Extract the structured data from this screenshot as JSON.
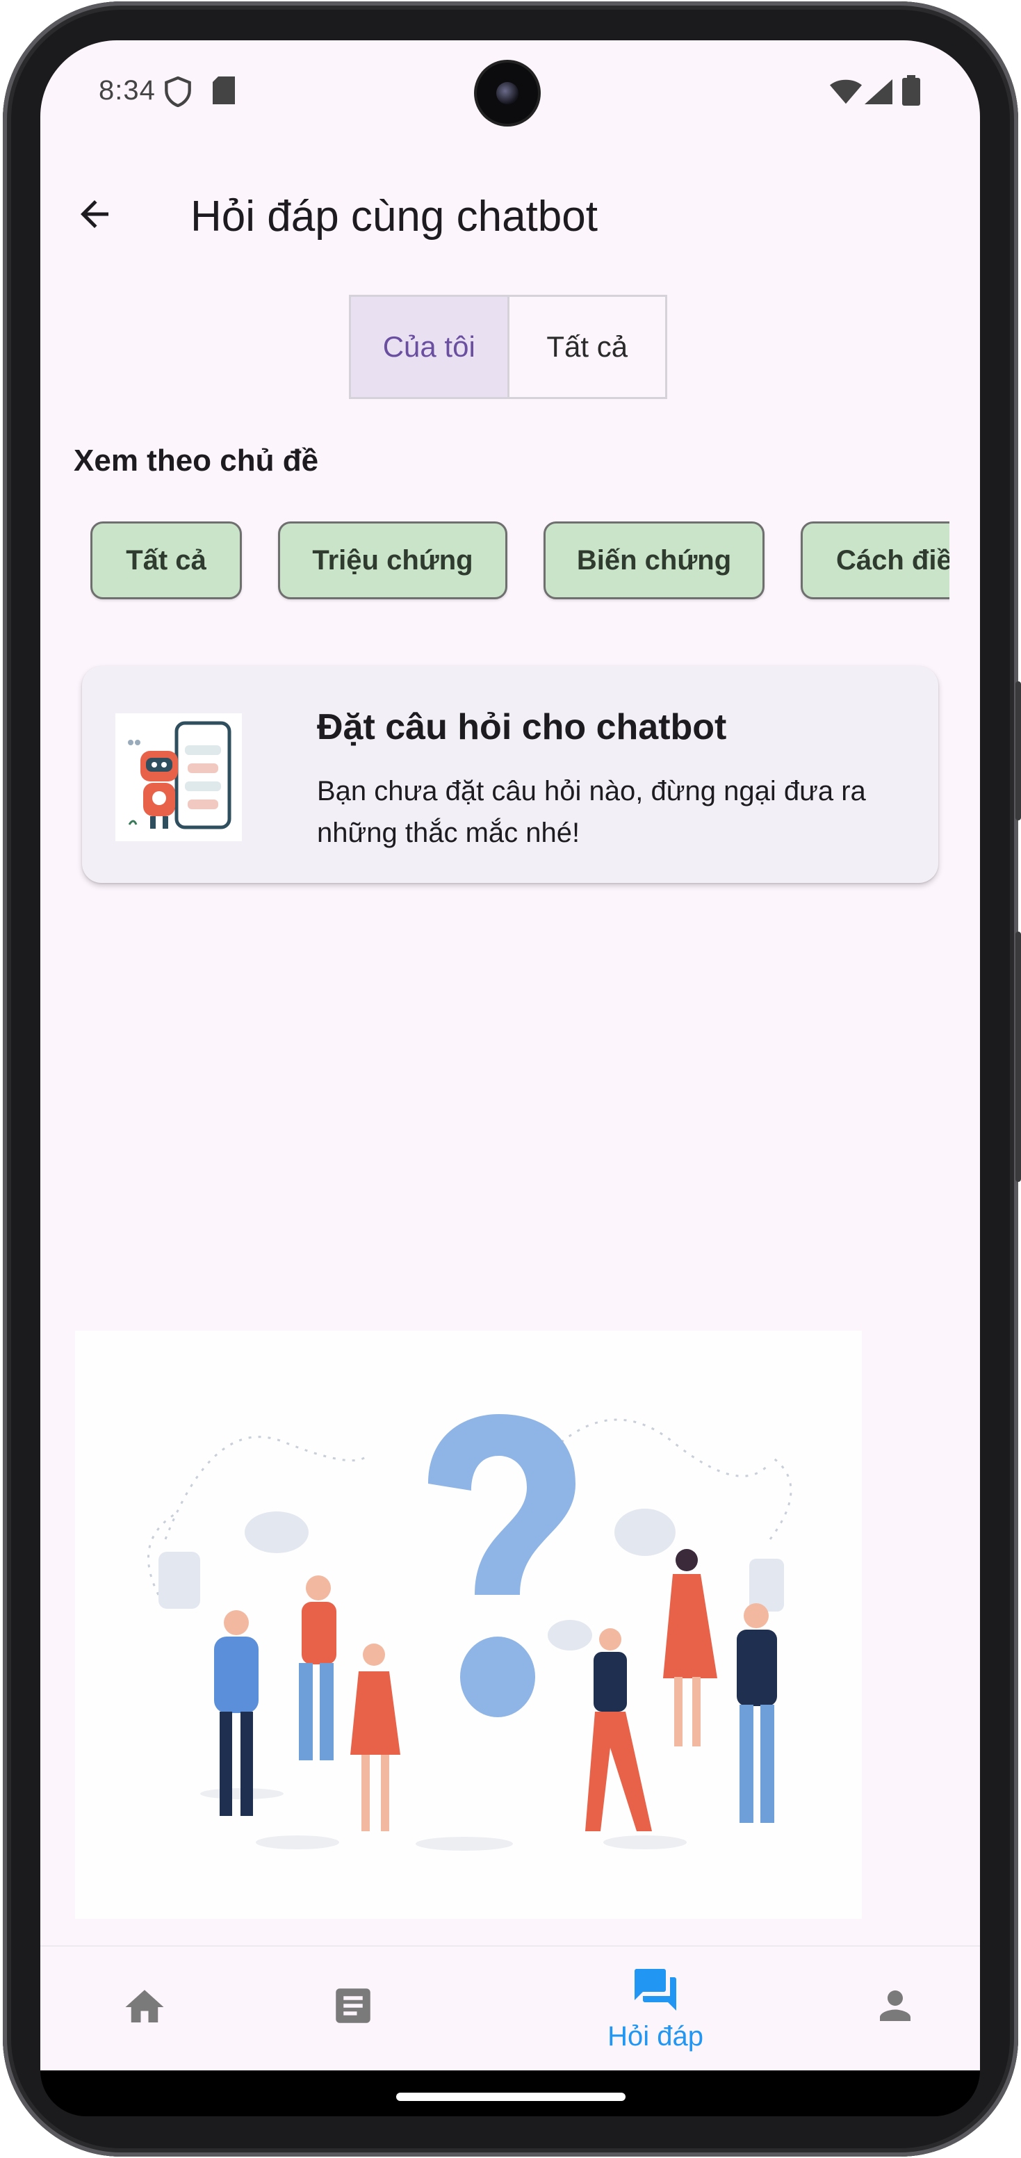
{
  "status_bar": {
    "time": "8:34",
    "icons": [
      "shield-icon",
      "sd-card-icon",
      "wifi-icon",
      "signal-icon",
      "battery-icon"
    ]
  },
  "app_bar": {
    "title": "Hỏi đáp cùng chatbot",
    "back_icon": "arrow-back-icon"
  },
  "segmented": {
    "options": [
      {
        "label": "Của tôi",
        "selected": true
      },
      {
        "label": "Tất cả",
        "selected": false
      }
    ]
  },
  "topics": {
    "title": "Xem theo chủ đề",
    "chips": [
      "Tất cả",
      "Triệu chứng",
      "Biến chứng",
      "Cách điều trị"
    ]
  },
  "card": {
    "title": "Đặt câu hỏi cho chatbot",
    "body": "Bạn chưa đặt câu hỏi nào, đừng ngại đưa ra những thắc mắc nhé!"
  },
  "bottom_nav": {
    "items": [
      {
        "icon": "home-icon",
        "label": "",
        "active": false
      },
      {
        "icon": "article-icon",
        "label": "",
        "active": false
      },
      {
        "icon": "forum-icon",
        "label": "Hỏi đáp",
        "active": true
      },
      {
        "icon": "person-icon",
        "label": "",
        "active": false
      }
    ]
  },
  "colors": {
    "background": "#fcf5fc",
    "segment_active_bg": "#e9e1f2",
    "segment_active_text": "#6a4fa0",
    "chip_bg": "#c9e4c8",
    "nav_active": "#2196f3",
    "nav_inactive": "#7a7a7a"
  }
}
